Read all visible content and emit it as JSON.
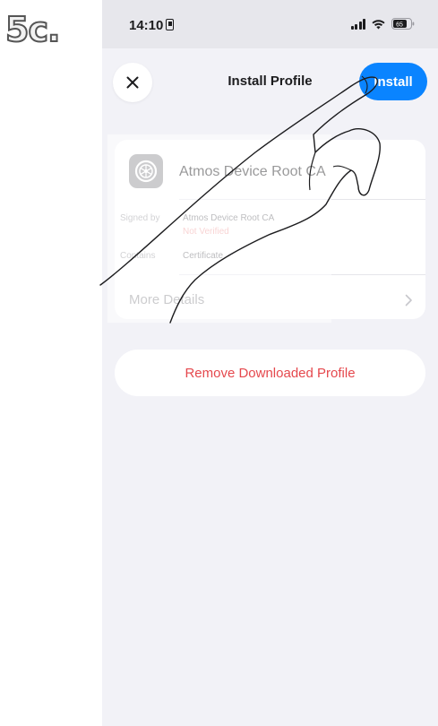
{
  "step_label": "5c.",
  "status_bar": {
    "time": "14:10",
    "battery": "65"
  },
  "sheet": {
    "title": "Install Profile",
    "install_label": "Install",
    "close_icon": "close-icon"
  },
  "profile": {
    "icon": "settings-gear-icon",
    "name": "Atmos Device Root CA",
    "signed_by_label": "Signed by",
    "signed_by_value": "Atmos Device Root CA",
    "verification_status": "Not Verified",
    "contains_label": "Contains",
    "contains_value": "Certificate",
    "more_details_label": "More Details"
  },
  "actions": {
    "remove_label": "Remove Downloaded Profile"
  },
  "colors": {
    "accent": "#0a84ff",
    "destructive": "#e5484d",
    "not_verified": "#f0a0a0",
    "background": "#f2f2f7"
  }
}
